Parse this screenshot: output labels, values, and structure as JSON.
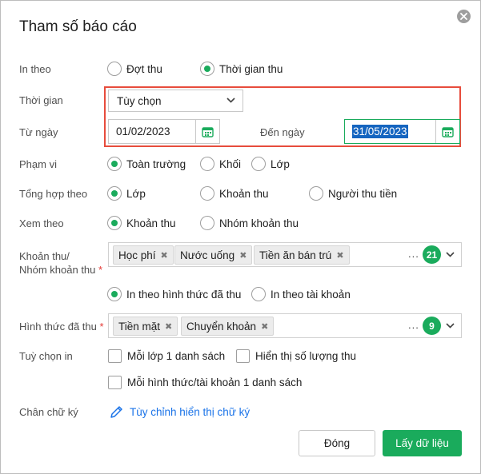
{
  "dialog": {
    "title": "Tham số báo cáo"
  },
  "in_theo": {
    "label": "In theo",
    "options": [
      "Đợt thu",
      "Thời gian thu"
    ],
    "selected": "Thời gian thu"
  },
  "thoi_gian": {
    "label": "Thời gian",
    "value": "Tùy chọn"
  },
  "tu_ngay": {
    "label": "Từ ngày",
    "value": "01/02/2023"
  },
  "den_ngay": {
    "label": "Đến ngày",
    "value": "31/05/2023"
  },
  "pham_vi": {
    "label": "Phạm vi",
    "options": [
      "Toàn trường",
      "Khối",
      "Lớp"
    ],
    "selected": "Toàn trường"
  },
  "tong_hop_theo": {
    "label": "Tổng hợp theo",
    "options": [
      "Lớp",
      "Khoản thu",
      "Người thu tiền"
    ],
    "selected": "Lớp"
  },
  "xem_theo": {
    "label": "Xem theo",
    "options": [
      "Khoản thu",
      "Nhóm khoản thu"
    ],
    "selected": "Khoản thu"
  },
  "khoan_thu": {
    "label_line1": "Khoản thu/",
    "label_line2": "Nhóm khoản thu",
    "required_mark": "*",
    "tags": [
      "Học phí",
      "Nước uống",
      "Tiền ăn bán trú"
    ],
    "more": "...",
    "count": "21"
  },
  "in_theo_hinh_thuc": {
    "options": [
      "In theo hình thức đã thu",
      "In theo tài khoản"
    ],
    "selected": "In theo hình thức đã thu"
  },
  "hinh_thuc": {
    "label": "Hình thức đã thu",
    "required_mark": "*",
    "tags": [
      "Tiền mặt",
      "Chuyển khoản"
    ],
    "more": "...",
    "count": "9"
  },
  "tuy_chon_in": {
    "label": "Tuỳ chọn in",
    "options": [
      "Mỗi lớp 1 danh sách",
      "Hiển thị số lượng thu",
      "Mỗi hình thức/tài khoản 1 danh sách"
    ]
  },
  "chan_chu_ky": {
    "label": "Chân chữ ký",
    "link": "Tùy chỉnh hiển thị chữ ký"
  },
  "buttons": {
    "close": "Đóng",
    "get_data": "Lấy dữ liệu"
  },
  "colors": {
    "accent": "#1aab5c",
    "highlight_border": "#e74c3c",
    "link": "#1a73e8"
  }
}
